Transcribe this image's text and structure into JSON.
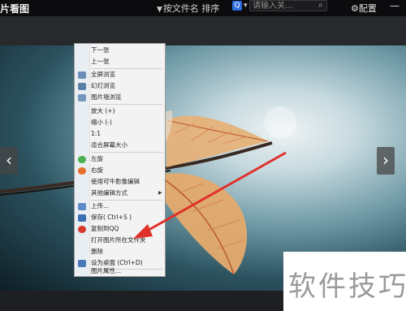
{
  "topbar": {
    "title": "片看图",
    "sort_label": "按文件名 排序",
    "search_placeholder": "请输入关…",
    "config_label": "配置",
    "minimize": "—"
  },
  "nav": {
    "prev": "‹",
    "next": "›"
  },
  "menu": {
    "items": [
      {
        "label": "下一张",
        "icon": ""
      },
      {
        "label": "上一张",
        "icon": ""
      },
      {
        "label": "全屏浏览",
        "icon": "fullscreen-icon"
      },
      {
        "label": "幻灯浏览",
        "icon": "slideshow-icon"
      },
      {
        "label": "图片墙浏览",
        "icon": "photo-wall-icon"
      },
      {
        "label": "放大 (+)",
        "icon": ""
      },
      {
        "label": "缩小 (-)",
        "icon": ""
      },
      {
        "label": "1:1",
        "icon": ""
      },
      {
        "label": "适合屏幕大小",
        "icon": ""
      },
      {
        "label": "左旋",
        "icon": "rotate-left-icon"
      },
      {
        "label": "右旋",
        "icon": "rotate-right-icon"
      },
      {
        "label": "使用可牛影像编辑",
        "icon": ""
      },
      {
        "label": "其他编辑方式",
        "icon": ""
      },
      {
        "label": "上传...",
        "icon": "upload-icon"
      },
      {
        "label": "保存( Ctrl+S )",
        "icon": "save-icon"
      },
      {
        "label": "复制到QQ",
        "icon": "qq-icon"
      },
      {
        "label": "打开图片所在文件夹",
        "icon": ""
      },
      {
        "label": "删除",
        "icon": ""
      },
      {
        "label": "设为桌面    (Ctrl+D)",
        "icon": "desktop-icon"
      },
      {
        "label": "图片属性...",
        "icon": ""
      }
    ]
  },
  "watermark": "软件技巧",
  "colors": {
    "accent_red": "#e0302a",
    "menu_bg": "#f3f3f3"
  }
}
